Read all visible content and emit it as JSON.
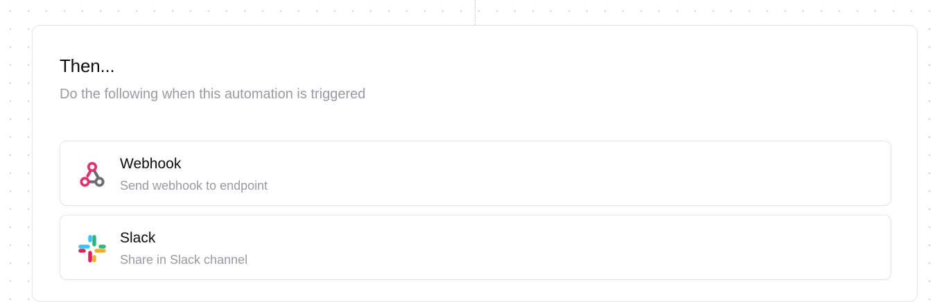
{
  "section": {
    "title": "Then...",
    "subtitle": "Do the following when this automation is triggered"
  },
  "actions": [
    {
      "icon": "webhook-icon",
      "title": "Webhook",
      "description": "Send webhook to endpoint"
    },
    {
      "icon": "slack-icon",
      "title": "Slack",
      "description": "Share in Slack channel"
    }
  ],
  "colors": {
    "webhook_pink": "#e0336b",
    "webhook_gray": "#6b6b73",
    "slack_blue": "#36c5f0",
    "slack_green": "#2eb67d",
    "slack_yellow": "#ecb22e",
    "slack_red": "#e01e5a"
  }
}
